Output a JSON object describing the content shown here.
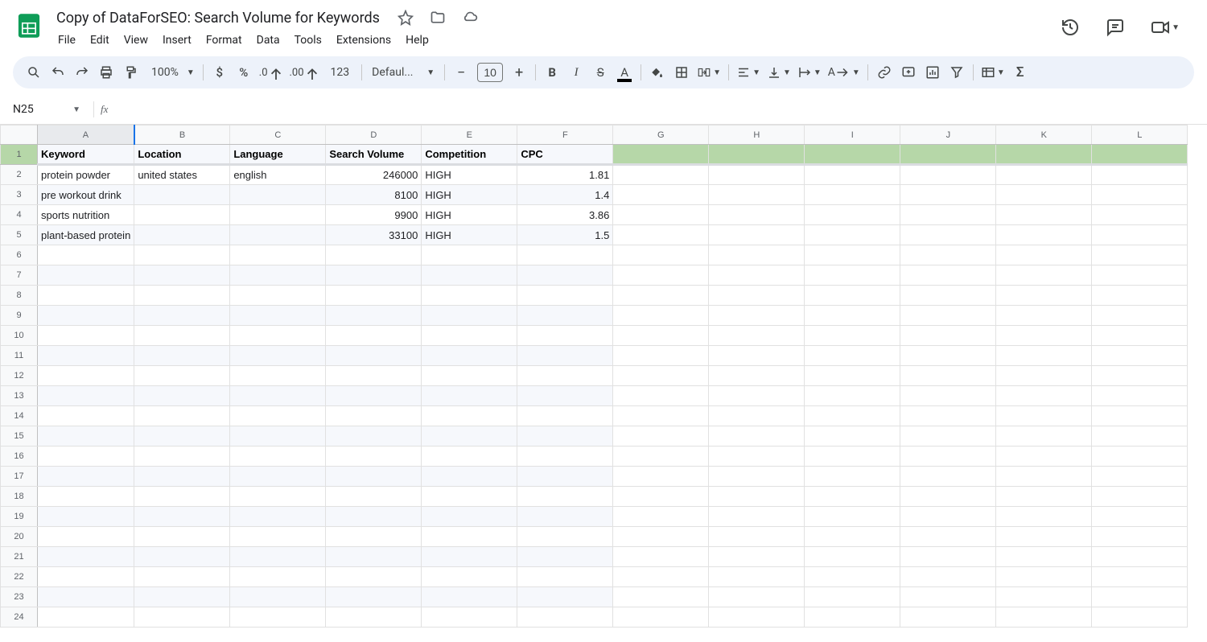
{
  "doc": {
    "title": "Copy of DataForSEO: Search Volume for Keywords"
  },
  "menus": [
    "File",
    "Edit",
    "View",
    "Insert",
    "Format",
    "Data",
    "Tools",
    "Extensions",
    "Help"
  ],
  "toolbar": {
    "zoom": "100%",
    "font": "Defaul...",
    "fontsize": "10",
    "format_number": "123"
  },
  "namebox": {
    "cell_ref": "N25",
    "formula": ""
  },
  "columns": [
    "A",
    "B",
    "C",
    "D",
    "E",
    "F",
    "G",
    "H",
    "I",
    "J",
    "K",
    "L"
  ],
  "row_count": 24,
  "headers": [
    "Keyword",
    "Location",
    "Language",
    "Search Volume",
    "Competition",
    "CPC"
  ],
  "rows": [
    {
      "keyword": "protein powder",
      "location": "united states",
      "language": "english",
      "search_volume": "246000",
      "competition": "HIGH",
      "cpc": "1.81"
    },
    {
      "keyword": "pre workout drink",
      "location": "",
      "language": "",
      "search_volume": "8100",
      "competition": "HIGH",
      "cpc": "1.4"
    },
    {
      "keyword": "sports nutrition",
      "location": "",
      "language": "",
      "search_volume": "9900",
      "competition": "HIGH",
      "cpc": "3.86"
    },
    {
      "keyword": "plant-based protein",
      "location": "",
      "language": "",
      "search_volume": "33100",
      "competition": "HIGH",
      "cpc": "1.5"
    }
  ]
}
